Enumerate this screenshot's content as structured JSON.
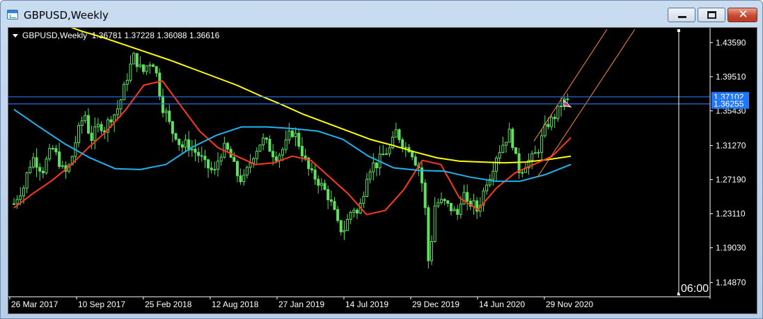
{
  "window": {
    "title": "GBPUSD,Weekly",
    "close_glyph": "✕"
  },
  "chart_header": {
    "text": "GBPUSD,Weekly  1.36781 1.37228 1.36088 1.36616"
  },
  "chart_data": {
    "type": "candlestick",
    "symbol": "GBPUSD",
    "timeframe": "Weekly",
    "ohlc_latest": [
      1.36781,
      1.37228,
      1.36088,
      1.36616
    ],
    "ylim": [
      1.135,
      1.452
    ],
    "y_ticks": [
      "1.43590",
      "1.39510",
      "1.35430",
      "1.31270",
      "1.27190",
      "1.23110",
      "1.19030",
      "1.14870"
    ],
    "x_ticks": [
      "26 Mar 2017",
      "10 Sep 2017",
      "25 Feb 2018",
      "12 Aug 2018",
      "27 Jan 2019",
      "14 Jul 2019",
      "29 Dec 2019",
      "14 Jun 2020",
      "29 Nov 2020"
    ],
    "price_tags": [
      "1.37102",
      "1.36255"
    ],
    "horizontal_lines": [
      1.37102,
      1.36255
    ],
    "time_label": "06:00",
    "close_series": [
      1.243,
      1.255,
      1.262,
      1.285,
      1.298,
      1.29,
      1.282,
      1.298,
      1.31,
      1.3,
      1.285,
      1.28,
      1.295,
      1.32,
      1.34,
      1.35,
      1.318,
      1.33,
      1.338,
      1.332,
      1.345,
      1.35,
      1.36,
      1.38,
      1.4,
      1.42,
      1.41,
      1.4,
      1.41,
      1.415,
      1.395,
      1.36,
      1.35,
      1.33,
      1.325,
      1.31,
      1.315,
      1.31,
      1.305,
      1.3,
      1.29,
      1.285,
      1.28,
      1.3,
      1.31,
      1.305,
      1.29,
      1.275,
      1.27,
      1.285,
      1.3,
      1.31,
      1.32,
      1.315,
      1.305,
      1.3,
      1.305,
      1.315,
      1.33,
      1.325,
      1.31,
      1.295,
      1.28,
      1.275,
      1.268,
      1.26,
      1.25,
      1.235,
      1.215,
      1.21,
      1.225,
      1.24,
      1.23,
      1.25,
      1.28,
      1.29,
      1.29,
      1.3,
      1.305,
      1.31,
      1.33,
      1.32,
      1.31,
      1.31,
      1.295,
      1.285,
      1.25,
      1.16,
      1.24,
      1.245,
      1.245,
      1.24,
      1.235,
      1.23,
      1.26,
      1.24,
      1.245,
      1.235,
      1.25,
      1.27,
      1.28,
      1.3,
      1.31,
      1.32,
      1.33,
      1.3,
      1.28,
      1.29,
      1.295,
      1.3,
      1.31,
      1.33,
      1.34,
      1.345,
      1.355,
      1.365,
      1.366
    ],
    "moving_averages": [
      {
        "color": "#ffff00",
        "values": [
          1.475,
          1.47,
          1.46,
          1.45,
          1.442,
          1.433,
          1.424,
          1.415,
          1.405,
          1.395,
          1.385,
          1.373,
          1.362,
          1.35,
          1.34,
          1.33,
          1.32,
          1.313,
          1.305,
          1.298,
          1.294,
          1.293,
          1.292,
          1.293,
          1.296,
          1.3
        ]
      },
      {
        "color": "#ff3a1a",
        "values": [
          1.238,
          1.255,
          1.27,
          1.288,
          1.31,
          1.33,
          1.355,
          1.385,
          1.39,
          1.36,
          1.33,
          1.31,
          1.3,
          1.29,
          1.292,
          1.3,
          1.295,
          1.275,
          1.255,
          1.23,
          1.235,
          1.26,
          1.295,
          1.29,
          1.25,
          1.236,
          1.262,
          1.28,
          1.29,
          1.3,
          1.322
        ]
      },
      {
        "color": "#20b4f0",
        "values": [
          1.356,
          1.335,
          1.315,
          1.298,
          1.285,
          1.284,
          1.29,
          1.31,
          1.325,
          1.335,
          1.335,
          1.333,
          1.33,
          1.32,
          1.3,
          1.286,
          1.283,
          1.282,
          1.275,
          1.27,
          1.27,
          1.278,
          1.29
        ]
      }
    ],
    "channel_lines": [
      {
        "color": "#ff8a3a"
      },
      {
        "color": "#ff8a3a"
      }
    ]
  }
}
